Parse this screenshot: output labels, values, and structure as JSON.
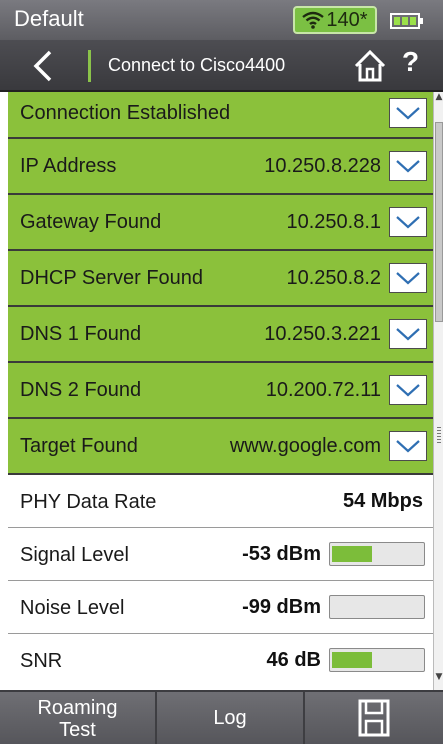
{
  "status": {
    "title": "Default",
    "wifi_count": "140*",
    "icons": [
      "wifi-icon",
      "battery-icon"
    ]
  },
  "nav": {
    "title": "Connect to Cisco4400",
    "help": "?",
    "icons": [
      "back-icon",
      "home-icon"
    ]
  },
  "rows": [
    {
      "label": "Connection Established",
      "value": ""
    },
    {
      "label": "IP Address",
      "value": "10.250.8.228"
    },
    {
      "label": "Gateway Found",
      "value": "10.250.8.1"
    },
    {
      "label": "DHCP Server Found",
      "value": "10.250.8.2"
    },
    {
      "label": "DNS 1 Found",
      "value": "10.250.3.221"
    },
    {
      "label": "DNS 2 Found",
      "value": "10.200.72.11"
    },
    {
      "label": "Target Found",
      "value": "www.google.com"
    }
  ],
  "metrics": [
    {
      "label": "PHY Data Rate",
      "value": "54 Mbps"
    },
    {
      "label": "Signal Level",
      "value": "-53 dBm",
      "level_percent": 45
    },
    {
      "label": "Noise Level",
      "value": "-99 dBm",
      "level_percent": 0
    },
    {
      "label": "SNR",
      "value": "46 dB",
      "level_percent": 45
    }
  ],
  "toolbar": {
    "roaming_line1": "Roaming",
    "roaming_line2": "Test",
    "log": "Log",
    "save_icon": "save-icon"
  },
  "colors": {
    "row_green": "#8bc13b",
    "meter_fill": "#7cbd3a",
    "wifi_badge": "#7bc043"
  }
}
